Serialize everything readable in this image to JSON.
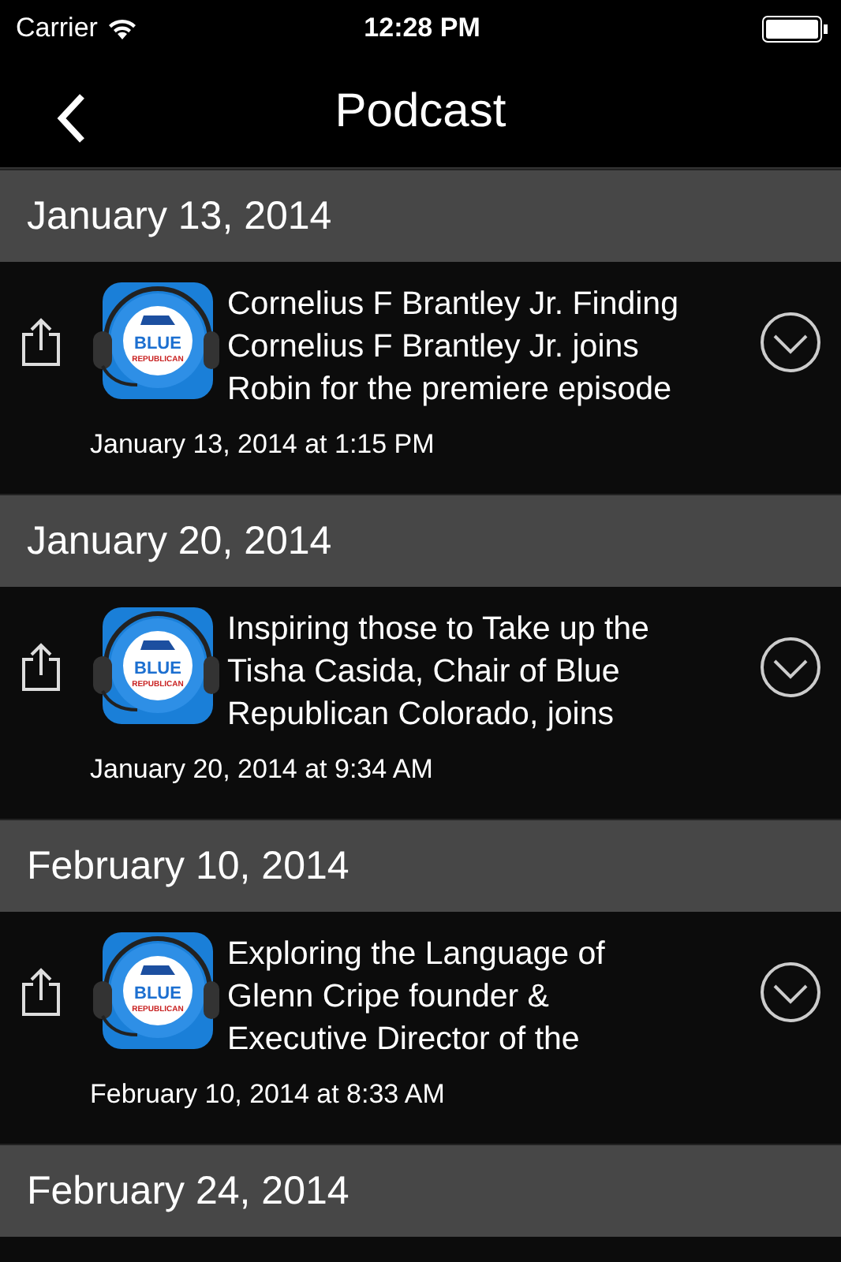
{
  "status_bar": {
    "carrier": "Carrier",
    "time": "12:28 PM"
  },
  "nav": {
    "title": "Podcast"
  },
  "sections": [
    {
      "date": "January 13, 2014",
      "episodes": [
        {
          "artwork": {
            "line_1": "BLUE",
            "line_2": "REPUBLICAN"
          },
          "lines": [
            "Cornelius F Brantley Jr. Finding",
            "Cornelius F Brantley Jr. joins",
            "Robin for the premiere episode"
          ],
          "published": "January 13, 2014 at 1:15 PM"
        }
      ]
    },
    {
      "date": "January 20, 2014",
      "episodes": [
        {
          "artwork": {
            "line_1": "BLUE",
            "line_2": "REPUBLICAN"
          },
          "lines": [
            "Inspiring those to Take up the",
            "Tisha Casida, Chair of Blue",
            "Republican Colorado, joins"
          ],
          "published": "January 20, 2014 at 9:34 AM"
        }
      ]
    },
    {
      "date": "February 10, 2014",
      "episodes": [
        {
          "artwork": {
            "line_1": "BLUE",
            "line_2": "REPUBLICAN"
          },
          "lines": [
            "Exploring the Language of",
            "Glenn Cripe founder &",
            "Executive Director of the"
          ],
          "published": "February 10, 2014 at 8:33 AM"
        }
      ]
    },
    {
      "date": "February 24, 2014"
    }
  ]
}
